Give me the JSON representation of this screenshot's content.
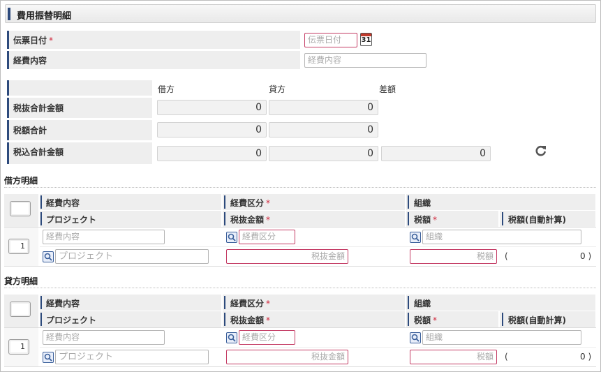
{
  "header": {
    "title": "費用振替明細"
  },
  "form": {
    "slip_date_label": "伝票日付",
    "required_mark": "*",
    "slip_date_placeholder": "伝票日付",
    "calendar_day": "31",
    "expense_content_label": "経費内容",
    "expense_content_placeholder": "経費内容"
  },
  "totals": {
    "col_debit": "借方",
    "col_credit": "貸方",
    "col_diff": "差額",
    "rows": [
      {
        "label": "税抜合計金額",
        "debit": "0",
        "credit": "0"
      },
      {
        "label": "税額合計",
        "debit": "0",
        "credit": "0"
      },
      {
        "label": "税込合計金額",
        "debit": "0",
        "credit": "0",
        "diff": "0"
      }
    ]
  },
  "debit_detail": {
    "title": "借方明細",
    "head": {
      "expense_content": "経費内容",
      "expense_category": "経費区分",
      "organization": "組織",
      "project": "プロジェクト",
      "amount_excl": "税抜金額",
      "tax": "税額",
      "tax_auto": "税額(自動計算)"
    },
    "row": {
      "number": "1",
      "expense_content_ph": "経費内容",
      "expense_category_ph": "経費区分",
      "organization_ph": "組織",
      "project_ph": "プロジェクト",
      "amount_ph": "税抜金額",
      "tax_ph": "税額",
      "paren_open": "(",
      "auto_tax_value": "0 )"
    }
  },
  "credit_detail": {
    "title": "貸方明細",
    "head": {
      "expense_content": "経費内容",
      "expense_category": "経費区分",
      "organization": "組織",
      "project": "プロジェクト",
      "amount_excl": "税抜金額",
      "tax": "税額",
      "tax_auto": "税額(自動計算)"
    },
    "row": {
      "number": "1",
      "expense_content_ph": "経費内容",
      "expense_category_ph": "経費区分",
      "organization_ph": "組織",
      "project_ph": "プロジェクト",
      "amount_ph": "税抜金額",
      "tax_ph": "税額",
      "paren_open": "(",
      "auto_tax_value": "0 )"
    }
  },
  "colors": {
    "accent": "#2d4a7c",
    "required": "#d0263b",
    "required_border": "#c43b64"
  }
}
